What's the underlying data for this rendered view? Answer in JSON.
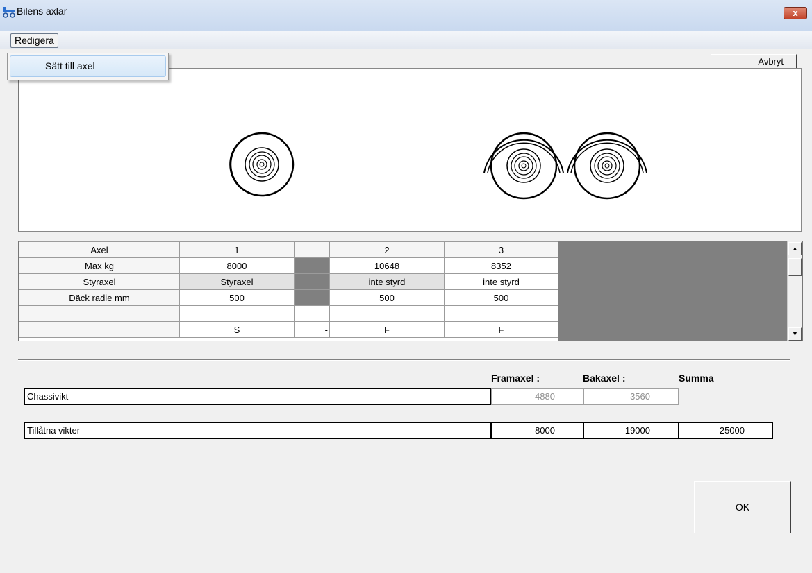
{
  "window": {
    "title": "Bilens axlar",
    "close_label": "x"
  },
  "menu": {
    "redigera_label": "Redigera",
    "dropdown_item_label": "Sätt till axel"
  },
  "toolbar": {
    "cancel_label": "Avbryt"
  },
  "axle_grid": {
    "row_labels": [
      "Axel",
      "Max kg",
      "Styraxel",
      "Däck radie mm",
      "",
      ""
    ],
    "columns": [
      {
        "cells": [
          "1",
          "8000",
          "Styraxel",
          "500",
          "",
          "S"
        ]
      },
      {
        "cells": [
          "",
          "",
          "",
          "",
          "",
          "-"
        ]
      },
      {
        "cells": [
          "2",
          "10648",
          "inte styrd",
          "500",
          "",
          "F"
        ]
      },
      {
        "cells": [
          "3",
          "8352",
          "inte styrd",
          "500",
          "",
          "F"
        ]
      }
    ]
  },
  "weights": {
    "headers": {
      "front": "Framaxel :",
      "rear": "Bakaxel :",
      "sum": "Summa"
    },
    "chassis": {
      "label": "Chassivikt",
      "front": "4880",
      "rear": "3560"
    },
    "allowed": {
      "label": "Tillåtna vikter",
      "front": "8000",
      "rear": "19000",
      "sum": "25000"
    }
  },
  "actions": {
    "ok_label": "OK"
  },
  "icons": {
    "app": "axle-icon",
    "close": "close-icon",
    "scroll_up": "arrow-up-icon",
    "scroll_down": "arrow-down-icon"
  },
  "colors": {
    "titlebar": "#c9d9ef",
    "close": "#c2432a",
    "grid_disabled": "#808080"
  }
}
